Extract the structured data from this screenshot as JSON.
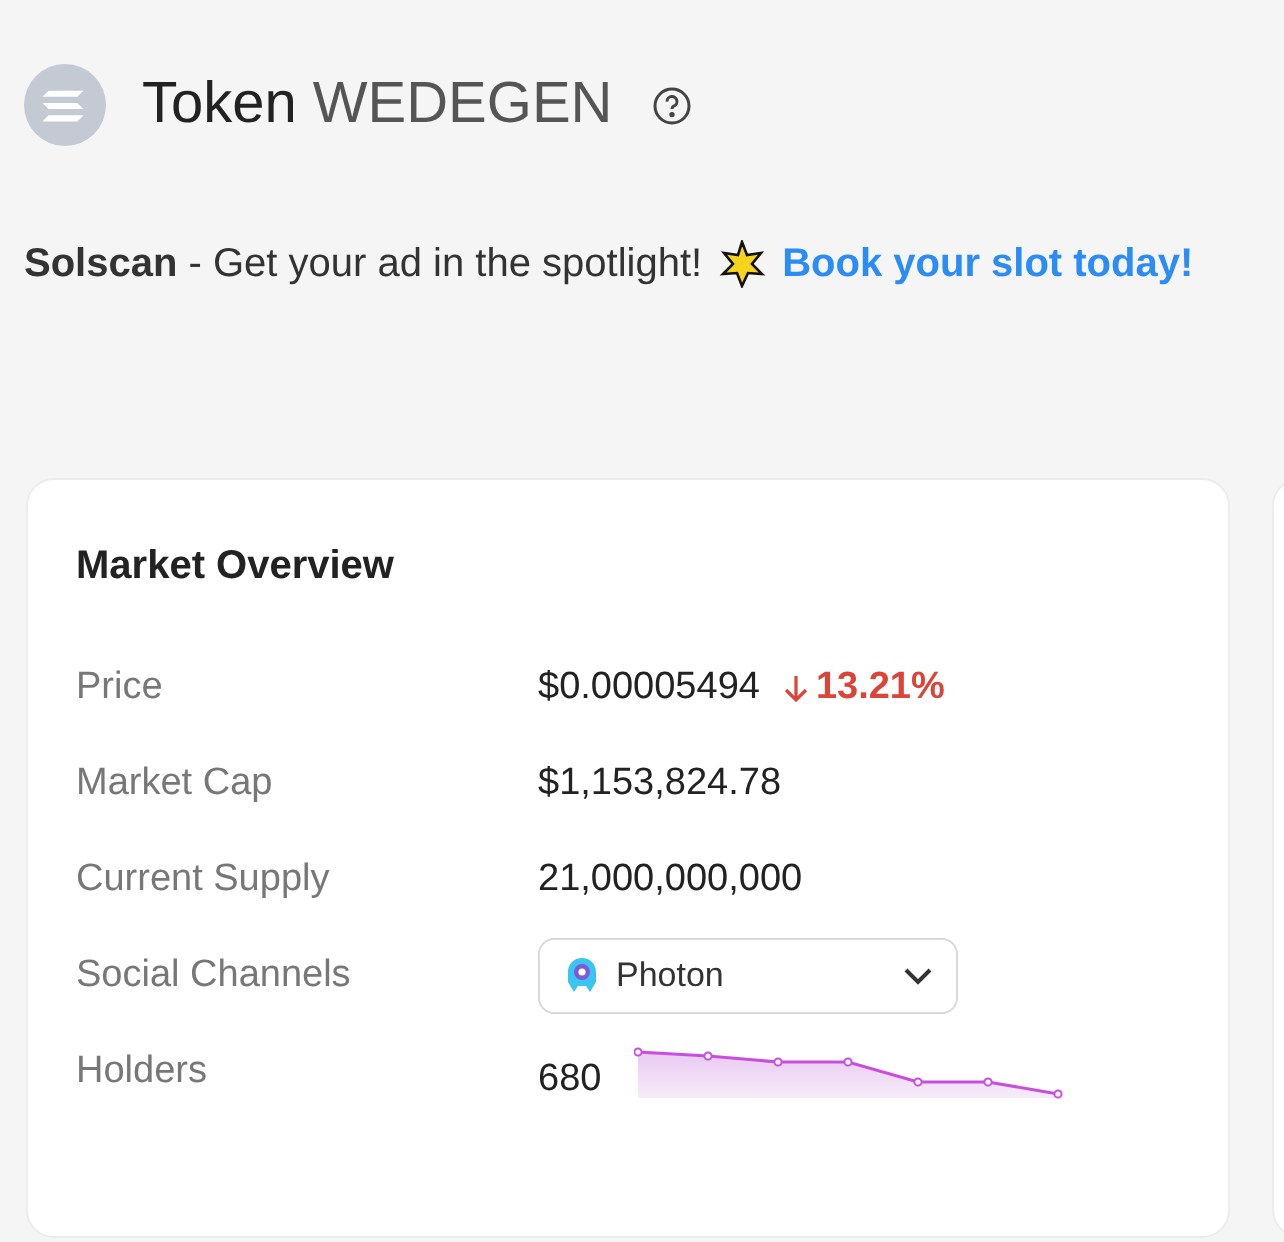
{
  "header": {
    "title": "Token",
    "token_name": "WEDEGEN"
  },
  "ad": {
    "text": "**Solscan** - Get your ad in the spotlight!",
    "link": "Book your slot today!"
  },
  "market_overview": {
    "title": "Market Overview",
    "rows": [
      {
        "kind": "price",
        "label": "Price",
        "value": "$0.00005494",
        "change": "13.21%"
      },
      {
        "kind": "text",
        "label": "Market Cap",
        "value": "$1,153,824.78"
      },
      {
        "kind": "text",
        "label": "Current Supply",
        "value": "21,000,000,000"
      },
      {
        "kind": "select",
        "label": "Social Channels",
        "value": "Photon"
      },
      {
        "kind": "sparkline",
        "label": "Holders",
        "value": "680"
      }
    ]
  }
}
